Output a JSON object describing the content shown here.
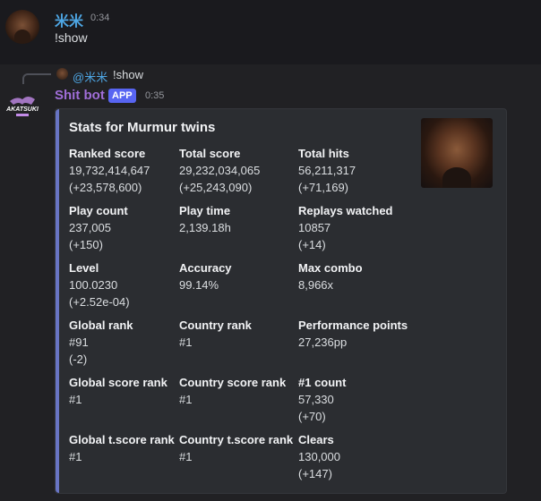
{
  "message1": {
    "username": "米米",
    "timestamp": "0:34",
    "content": "!show"
  },
  "reply": {
    "username": "@米米",
    "content": "!show"
  },
  "message2": {
    "botname": "Shit bot",
    "badge": "APP",
    "timestamp": "0:35",
    "logo_text": "AKATSUKI"
  },
  "embed": {
    "title": "Stats for Murmur twins",
    "accent": "#6874c4",
    "fields": [
      {
        "name": "Ranked score",
        "line1": "19,732,414,647",
        "line2": "(+23,578,600)"
      },
      {
        "name": "Total score",
        "line1": "29,232,034,065",
        "line2": "(+25,243,090)"
      },
      {
        "name": "Total hits",
        "line1": "56,211,317",
        "line2": "(+71,169)"
      },
      {
        "name": "Play count",
        "line1": "237,005",
        "line2": "(+150)"
      },
      {
        "name": "Play time",
        "line1": "2,139.18h",
        "line2": ""
      },
      {
        "name": "Replays watched",
        "line1": "10857",
        "line2": "(+14)"
      },
      {
        "name": "Level",
        "line1": "100.0230",
        "line2": "(+2.52e-04)"
      },
      {
        "name": "Accuracy",
        "line1": "99.14%",
        "line2": ""
      },
      {
        "name": "Max combo",
        "line1": "8,966x",
        "line2": ""
      },
      {
        "name": "Global rank",
        "line1": "#91",
        "line2": "(-2)"
      },
      {
        "name": "Country rank",
        "line1": "#1",
        "line2": ""
      },
      {
        "name": "Performance points",
        "line1": "27,236pp",
        "line2": ""
      },
      {
        "name": "Global score rank",
        "line1": "#1",
        "line2": ""
      },
      {
        "name": "Country score rank",
        "line1": "#1",
        "line2": ""
      },
      {
        "name": "#1 count",
        "line1": "57,330",
        "line2": "(+70)"
      },
      {
        "name": "Global t.score rank",
        "line1": "#1",
        "line2": ""
      },
      {
        "name": "Country t.score rank",
        "line1": "#1",
        "line2": ""
      },
      {
        "name": "Clears",
        "line1": "130,000",
        "line2": "(+147)"
      }
    ]
  }
}
